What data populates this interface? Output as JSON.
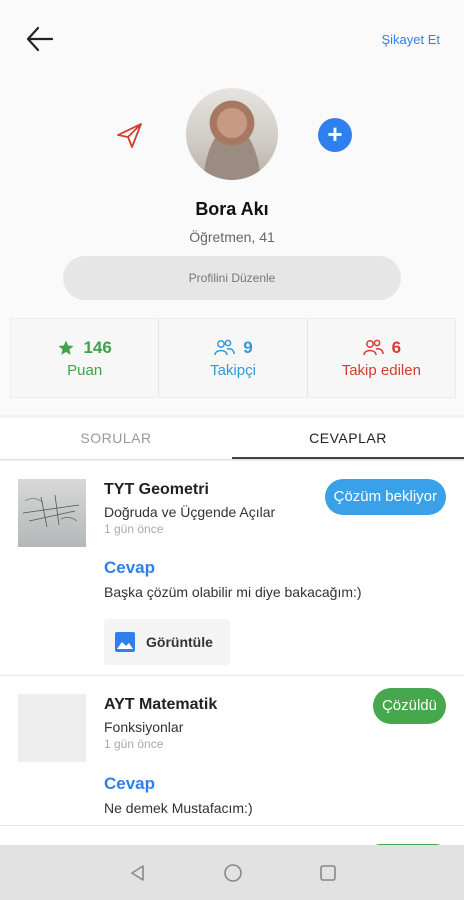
{
  "header": {
    "report_label": "Şikayet Et"
  },
  "profile": {
    "name": "Bora Akı",
    "subtitle": "Öğretmen, 41",
    "edit_label": "Profilini Düzenle"
  },
  "stats": [
    {
      "value": "146",
      "label": "Puan",
      "icon": "star-icon",
      "color": "#3fa34d"
    },
    {
      "value": "9",
      "label": "Takipçi",
      "icon": "followers-icon",
      "color": "#2f9ad8"
    },
    {
      "value": "6",
      "label": "Takip edilen",
      "icon": "following-icon",
      "color": "#d43d2f"
    }
  ],
  "tabs": [
    {
      "label": "SORULAR",
      "active": false
    },
    {
      "label": "CEVAPLAR",
      "active": true
    }
  ],
  "answers": [
    {
      "subject": "TYT Geometri",
      "topic": "Doğruda ve Üçgende Açılar",
      "time": "1 gün önce",
      "status": "Çözüm bekliyor",
      "status_color": "#3aa0e8",
      "answer_heading": "Cevap",
      "answer_text": "Başka çözüm olabilir mi diye bakacağım:)",
      "view_label": "Görüntüle"
    },
    {
      "subject": "AYT Matematik",
      "topic": "Fonksiyonlar",
      "time": "1 gün önce",
      "status": "Çözüldü",
      "status_color": "#45a84c",
      "answer_heading": "Cevap",
      "answer_text": "Ne demek Mustafacım:)"
    }
  ],
  "colors": {
    "accent": "#2f80ed",
    "green": "#3fa34d",
    "red": "#d43d2f",
    "blue": "#2f9ad8"
  }
}
